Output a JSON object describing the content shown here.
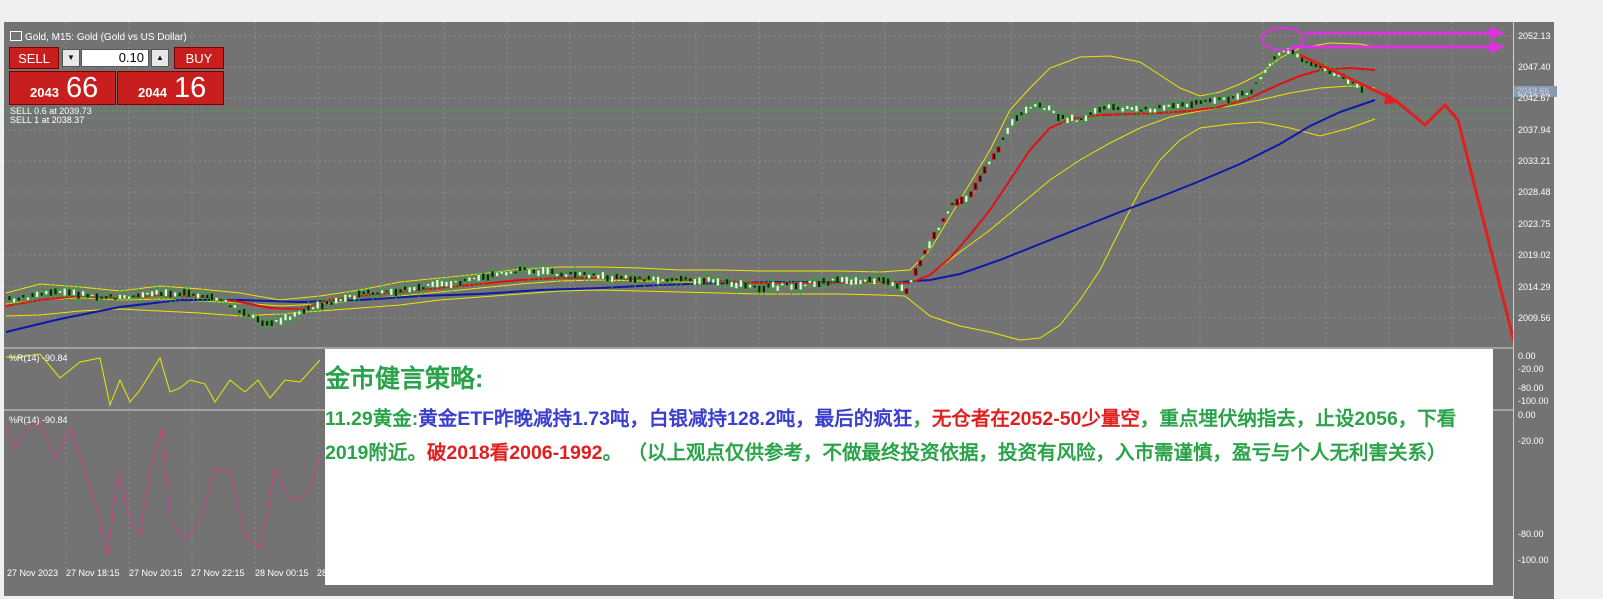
{
  "chart": {
    "title": "Gold, M15:  Gold (Gold vs US Dollar)",
    "trade_panel": {
      "sell_label": "SELL",
      "buy_label": "BUY",
      "lot": "0.10",
      "sell_price_small": "2043",
      "sell_price_big": "66",
      "buy_price_small": "2044",
      "buy_price_big": "16"
    },
    "orders": [
      "SELL 0.6 at 2039.73",
      "SELL 1 at 2038.37"
    ],
    "current_price": "2043.66",
    "price_axis": [
      "2052.13",
      "2047.40",
      "2042.67",
      "2037.94",
      "2033.21",
      "2028.48",
      "2023.75",
      "2019.02",
      "2014.29",
      "2009.56"
    ],
    "wpr1": {
      "label": "%R(14) -90.84",
      "axis": [
        "0.00",
        "-20.00",
        "-80.00",
        "-100.00"
      ]
    },
    "wpr2": {
      "label": "%R(14) -90.84",
      "axis": [
        "0.00",
        "-20.00",
        "-80.00",
        "-100.00"
      ]
    },
    "time_axis": [
      "27 Nov 2023",
      "27 Nov 18:15",
      "27 Nov 20:15",
      "27 Nov 22:15",
      "28 Nov 00:15",
      "28"
    ],
    "colors": {
      "background": "#737373",
      "ma_fast": "#e01010",
      "ma_slow": "#0b1aa8",
      "bollinger": "#e8e800",
      "wpr1": "#e8e800",
      "wpr2": "#d0408a",
      "annotation": "#e030e0",
      "arrow": "#e02020"
    }
  },
  "note": {
    "title": "金市健言策略:",
    "segments": [
      {
        "text": "11.29黄金:",
        "color": "green"
      },
      {
        "text": "黄金ETF昨晚减持1.73吨，白银减持128.2吨，最后的疯狂",
        "color": "blue"
      },
      {
        "text": "，",
        "color": "green"
      },
      {
        "text": "无仓者在2052-50少量空",
        "color": "red"
      },
      {
        "text": "，重点埋伏纳指去，止设2056，下看2019附近。",
        "color": "green"
      },
      {
        "text": "破2018看2006-1992",
        "color": "red"
      },
      {
        "text": "。 （以上观点仅供参考，不做最终投资依据，投资有风险，入市需谨慎，盈亏与个人无利害关系）",
        "color": "green"
      }
    ]
  }
}
